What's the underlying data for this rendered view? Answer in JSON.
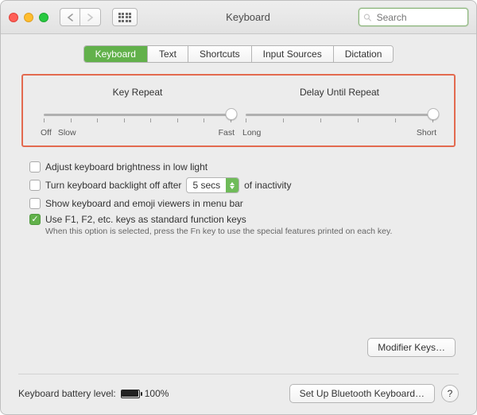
{
  "titlebar": {
    "title": "Keyboard",
    "search_placeholder": "Search"
  },
  "tabs": [
    {
      "label": "Keyboard",
      "active": true
    },
    {
      "label": "Text",
      "active": false
    },
    {
      "label": "Shortcuts",
      "active": false
    },
    {
      "label": "Input Sources",
      "active": false
    },
    {
      "label": "Dictation",
      "active": false
    }
  ],
  "sliders": {
    "repeat": {
      "title": "Key Repeat",
      "left_label": "Off",
      "left_label2": "Slow",
      "right_label": "Fast",
      "tick_count": 8,
      "knob_percent": 100
    },
    "delay": {
      "title": "Delay Until Repeat",
      "left_label": "Long",
      "right_label": "Short",
      "tick_count": 6,
      "knob_percent": 100
    }
  },
  "options": {
    "auto_brightness": {
      "label": "Adjust keyboard brightness in low light",
      "checked": false
    },
    "backlight_off": {
      "label_before": "Turn keyboard backlight off after",
      "dropdown_value": "5 secs",
      "label_after": "of inactivity",
      "checked": false
    },
    "emoji_viewer": {
      "label": "Show keyboard and emoji viewers in menu bar",
      "checked": false
    },
    "fn_keys": {
      "label": "Use F1, F2, etc. keys as standard function keys",
      "hint": "When this option is selected, press the Fn key to use the special features printed on each key.",
      "checked": true
    }
  },
  "buttons": {
    "modifier_keys": "Modifier Keys…",
    "bluetooth": "Set Up Bluetooth Keyboard…",
    "help": "?"
  },
  "battery": {
    "label_prefix": "Keyboard battery level:",
    "percent": "100%"
  }
}
